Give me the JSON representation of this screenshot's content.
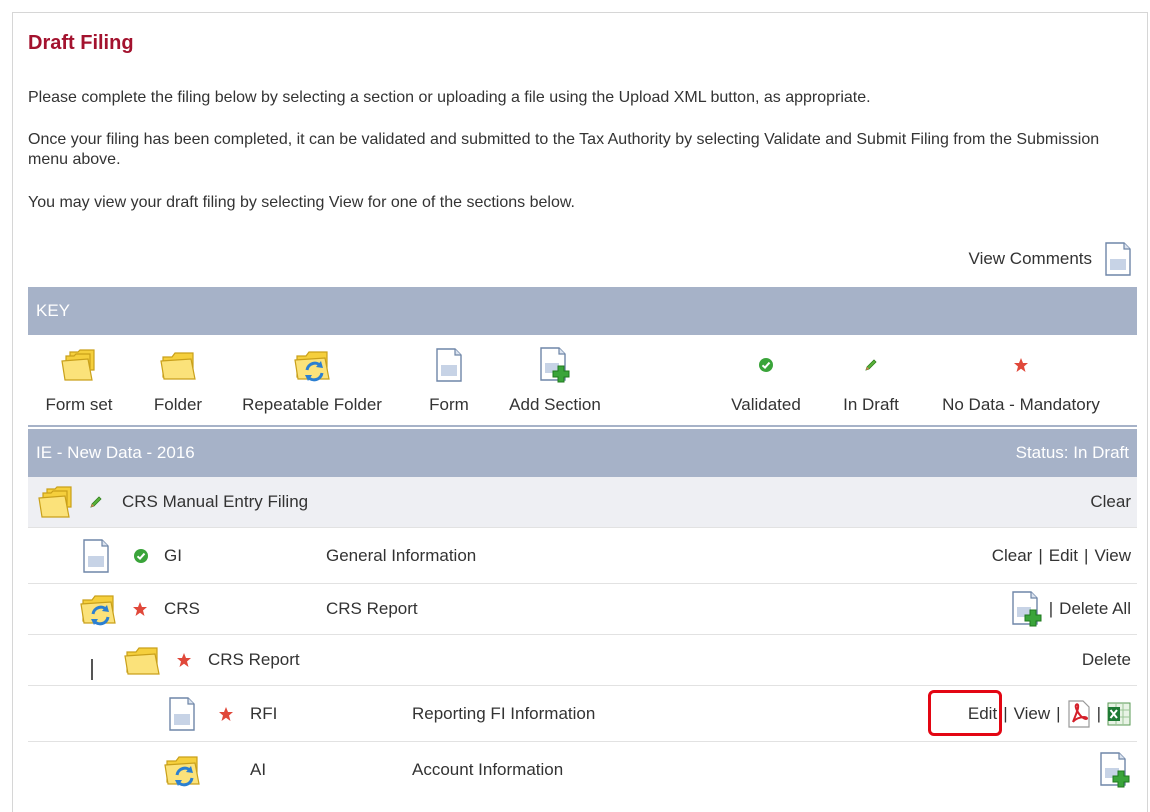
{
  "title": "Draft Filing",
  "intro": {
    "p1": "Please complete the filing below by selecting a section or uploading a file using the Upload XML button, as appropriate.",
    "p2": "Once your filing has been completed, it can be validated and submitted to the Tax Authority by selecting Validate and Submit Filing from the Submission menu above.",
    "p3": "You may view your draft filing by selecting View for one of the sections below."
  },
  "view_comments": "View Comments",
  "key": {
    "header": "KEY",
    "items": {
      "form_set": "Form set",
      "folder": "Folder",
      "repeatable_folder": "Repeatable Folder",
      "form": "Form",
      "add_section": "Add Section",
      "validated": "Validated",
      "in_draft": "In Draft",
      "no_data_mandatory": "No Data - Mandatory"
    }
  },
  "filing": {
    "name": "IE - New Data - 2016",
    "status": "Status: In Draft",
    "root": {
      "label": "CRS Manual Entry Filing",
      "action": "Clear"
    },
    "gi": {
      "code": "GI",
      "desc": "General Information",
      "clear": "Clear",
      "edit": "Edit",
      "view": "View"
    },
    "crs": {
      "code": "CRS",
      "desc": "CRS Report",
      "delete_all": "Delete All"
    },
    "crs_report": {
      "label": "CRS Report",
      "delete": "Delete"
    },
    "rfi": {
      "code": "RFI",
      "desc": "Reporting FI Information",
      "edit": "Edit",
      "view": "View"
    },
    "ai": {
      "code": "AI",
      "desc": "Account Information"
    }
  },
  "separator": "|",
  "colors": {
    "title": "#a3122e",
    "header_bg": "#a6b2c8",
    "folder_yellow": "#f7d54a",
    "validated_green": "#3aa43a",
    "mandatory_red": "#e0483a",
    "highlight_red": "#e30613"
  }
}
